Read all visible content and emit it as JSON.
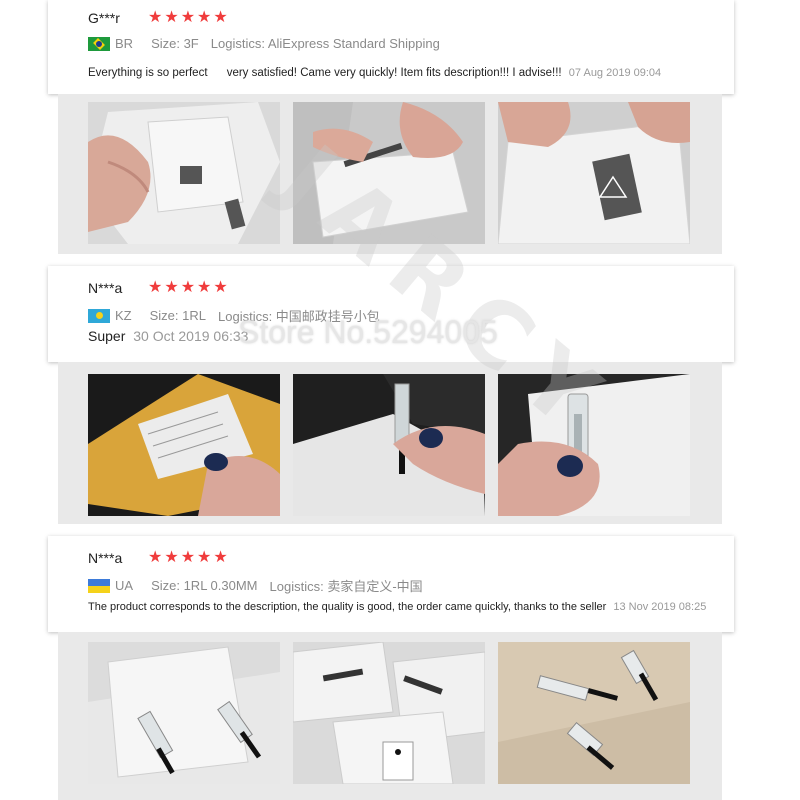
{
  "reviews": [
    {
      "name": "G***r",
      "stars": 5,
      "country": "BR",
      "size": "Size: 3F",
      "logistics": "Logistics: AliExpress Standard Shipping",
      "text": "Everything is so perfect      very satisfied! Came very quickly! Item fits description!!! I advise!!!",
      "date": "07 Aug 2019 09:04"
    },
    {
      "name": "N***a",
      "stars": 5,
      "country": "KZ",
      "size": "Size: 1RL",
      "logistics": "Logistics: 中国邮政挂号小包",
      "text": "Super",
      "date": "30 Oct 2019 06:33"
    },
    {
      "name": "N***a",
      "stars": 5,
      "country": "UA",
      "size": "Size: 1RL 0.30MM",
      "logistics": "Logistics: 卖家自定义-中国",
      "text": "The product corresponds to the description, the quality is good, the order came quickly, thanks to the seller",
      "date": "13 Nov 2019 08:25"
    }
  ],
  "watermark": {
    "store": "Store No.5294005",
    "brand": "JARCY"
  },
  "colors": {
    "star": "#f03c3c",
    "meta": "#8a8a8a",
    "strip": "#e9e9e9"
  }
}
